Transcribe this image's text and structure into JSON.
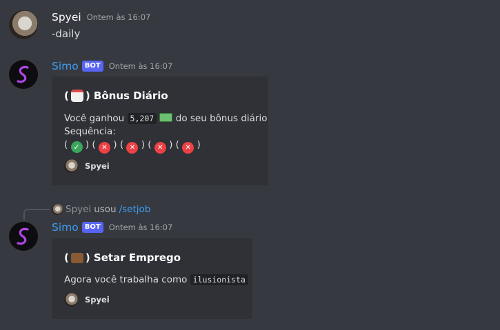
{
  "messages": [
    {
      "username": "Spyei",
      "timestamp": "Ontem às 16:07",
      "content": "-daily"
    },
    {
      "username": "Simo",
      "bot_tag": "BOT",
      "timestamp": "Ontem às 16:07",
      "embed": {
        "title_open": "(",
        "title_icon": "calendar-emoji",
        "title_close": ") Bônus Diário",
        "desc_prefix": "Você ganhou",
        "amount": "5,207",
        "amount_icon": "money-emoji",
        "desc_suffix": "do seu bônus diário",
        "streak_label": "Sequência:",
        "streak": [
          "check",
          "x",
          "x",
          "x",
          "x"
        ],
        "footer_user": "Spyei"
      }
    },
    {
      "reply": {
        "user": "Spyei",
        "verb": "usou",
        "command": "/setjob"
      },
      "username": "Simo",
      "bot_tag": "BOT",
      "timestamp": "Ontem às 16:07",
      "embed": {
        "title_open": "(",
        "title_icon": "briefcase-emoji",
        "title_close": ") Setar Emprego",
        "desc_prefix": "Agora você trabalha como",
        "job": "ilusionista",
        "footer_user": "Spyei"
      }
    }
  ],
  "colors": {
    "background": "#36393f",
    "embed": "#2f3136",
    "bot_name": "#3e9df6",
    "bot_tag": "#5865f2"
  }
}
